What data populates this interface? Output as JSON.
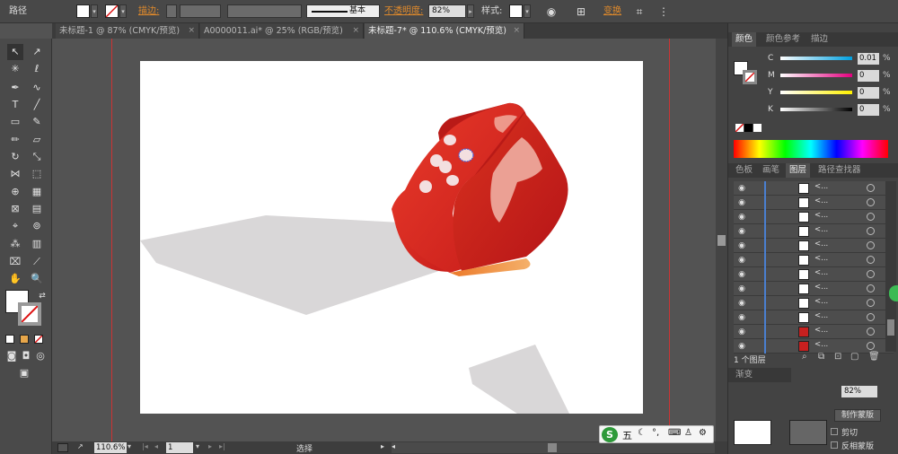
{
  "control_bar": {
    "mode_label": "路径",
    "stroke_label": "描边:",
    "stroke_style_label": "基本",
    "opacity_label": "不透明度:",
    "opacity_value": "82%",
    "style_label": "样式:",
    "transform_label": "变换"
  },
  "tabs": [
    {
      "label": "未标题-1 @ 87% (CMYK/预览)",
      "close": "×"
    },
    {
      "label": "A0000011.ai* @ 25% (RGB/预览)",
      "close": "×"
    },
    {
      "label": "未标题-7* @ 110.6% (CMYK/预览)",
      "close": "×"
    }
  ],
  "status": {
    "zoom": "110.6%",
    "page": "1",
    "mode": "选择"
  },
  "color_panel": {
    "tabs": [
      "颜色",
      "颜色参考",
      "描边"
    ],
    "channels": [
      {
        "label": "C",
        "value": "0.01",
        "unit": "%"
      },
      {
        "label": "M",
        "value": "0",
        "unit": "%"
      },
      {
        "label": "Y",
        "value": "0",
        "unit": "%"
      },
      {
        "label": "K",
        "value": "0",
        "unit": "%"
      }
    ]
  },
  "layers_panel": {
    "tabs": [
      "色板",
      "画笔",
      "图层",
      "路径查找器"
    ],
    "footer_text": "1 个图层",
    "rows": [
      {
        "name": "<..."
      },
      {
        "name": "<..."
      },
      {
        "name": "<..."
      },
      {
        "name": "<..."
      },
      {
        "name": "<..."
      },
      {
        "name": "<..."
      },
      {
        "name": "<..."
      },
      {
        "name": "<..."
      },
      {
        "name": "<..."
      },
      {
        "name": "<..."
      },
      {
        "name": "<..."
      },
      {
        "name": "<..."
      }
    ]
  },
  "bottom_panel": {
    "tab": "渐变",
    "opacity_value": "82%",
    "make_mask": "制作蒙版",
    "clip": "剪切",
    "invert_mask": "反相蒙版"
  },
  "ime_bar": {
    "label": "五"
  },
  "colors": {
    "dice_red": "#c8201f",
    "shadow": "#d9d7d8",
    "accent_orange": "#e08a2b"
  }
}
